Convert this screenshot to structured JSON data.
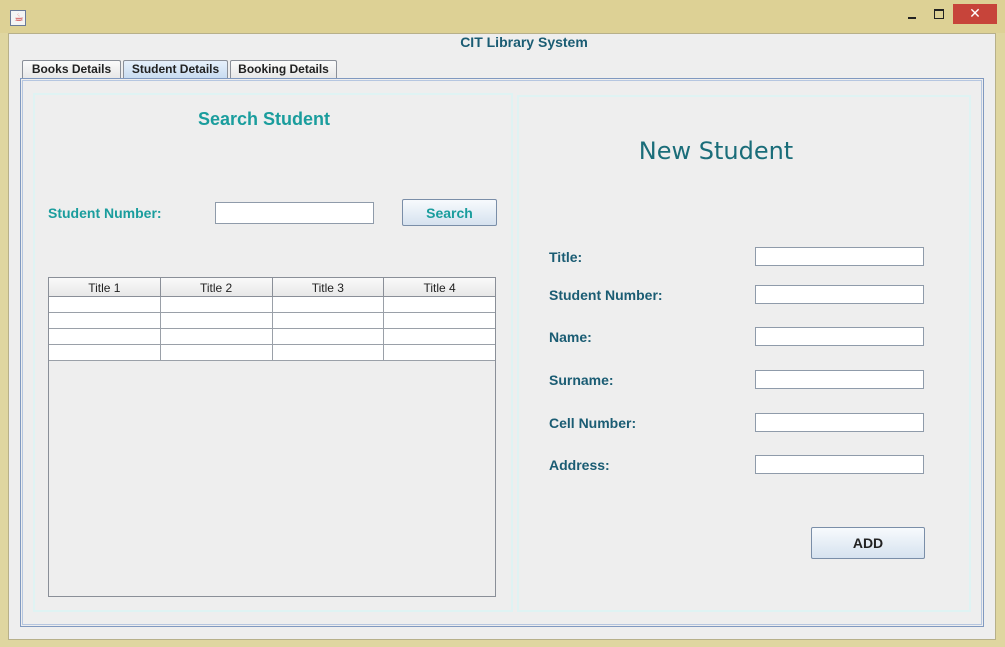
{
  "window": {
    "close_glyph": "✕"
  },
  "app": {
    "title": "CIT Library System"
  },
  "tabs": [
    {
      "label": "Books Details",
      "active": false
    },
    {
      "label": "Student Details",
      "active": true
    },
    {
      "label": "Booking Details",
      "active": false
    }
  ],
  "search_panel": {
    "title": "Search Student",
    "student_number_label": "Student Number:",
    "student_number_value": "",
    "search_button": "Search",
    "table": {
      "columns": [
        "Title 1",
        "Title 2",
        "Title 3",
        "Title 4"
      ],
      "rows": [
        [
          "",
          "",
          "",
          ""
        ],
        [
          "",
          "",
          "",
          ""
        ],
        [
          "",
          "",
          "",
          ""
        ],
        [
          "",
          "",
          "",
          ""
        ]
      ]
    }
  },
  "new_student": {
    "title": "New Student",
    "fields": [
      {
        "label": "Title:",
        "value": ""
      },
      {
        "label": "Student Number:",
        "value": ""
      },
      {
        "label": "Name:",
        "value": ""
      },
      {
        "label": "Surname:",
        "value": ""
      },
      {
        "label": "Cell Number:",
        "value": ""
      },
      {
        "label": "Address:",
        "value": ""
      }
    ],
    "add_button": "ADD"
  },
  "colors": {
    "accent_teal": "#1a9d9d",
    "label_blue": "#1a5c73",
    "close_red": "#c7443a"
  },
  "icons": {
    "app": "java-cup-icon",
    "minimize": "minimize-icon",
    "maximize": "maximize-icon",
    "close": "close-icon"
  }
}
